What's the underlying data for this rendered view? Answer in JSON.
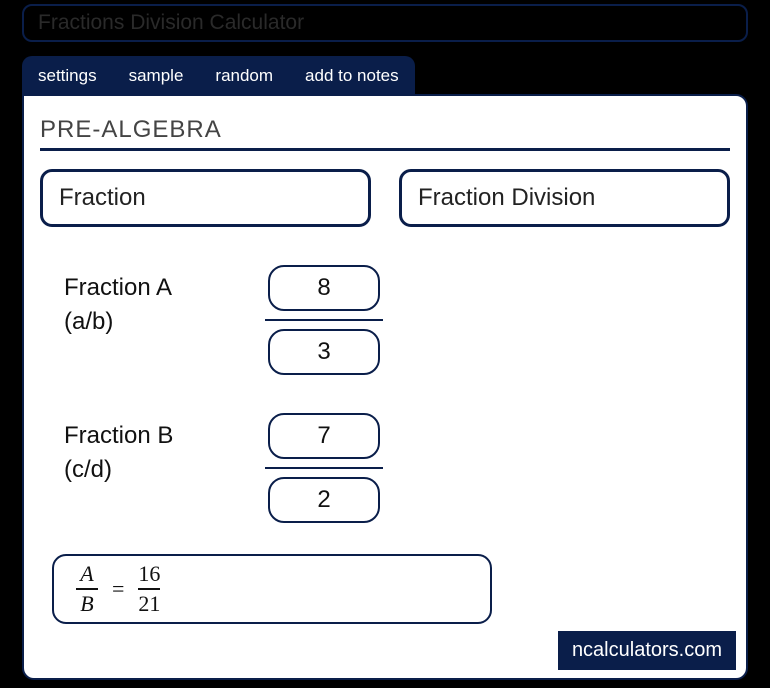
{
  "title": "Fractions Division Calculator",
  "tabs": {
    "settings": "settings",
    "sample": "sample",
    "random": "random",
    "add_to_notes": "add to notes"
  },
  "category": "PRE-ALGEBRA",
  "selects": {
    "left": "Fraction",
    "right": "Fraction Division"
  },
  "fraction_a": {
    "label": "Fraction A",
    "sub": "(a/b)",
    "numerator": "8",
    "denominator": "3"
  },
  "fraction_b": {
    "label": "Fraction B",
    "sub": "(c/d)",
    "numerator": "7",
    "denominator": "2"
  },
  "result": {
    "lhs_top": "A",
    "lhs_bot": "B",
    "eq": "=",
    "rhs_top": "16",
    "rhs_bot": "21"
  },
  "brand": "ncalculators.com"
}
